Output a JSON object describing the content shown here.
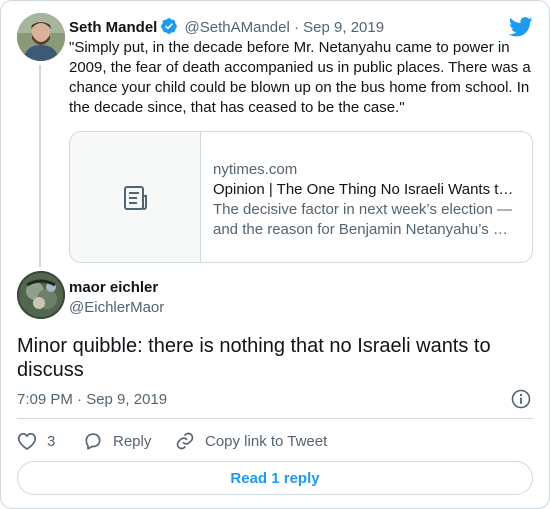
{
  "parent_tweet": {
    "author_name": "Seth Mandel",
    "author_handle": "@SethAMandel",
    "separator": "·",
    "date": "Sep 9, 2019",
    "text": "\"Simply put, in the decade before Mr. Netanyahu came to power in 2009, the fear of death accompanied us in public places. There was a chance your child could be blown up on the bus home from school. In the decade since, that has ceased to be the case.\"",
    "link_card": {
      "domain": "nytimes.com",
      "title": "Opinion | The One Thing No Israeli Wants t…",
      "description_line1": "The decisive factor in next week’s election —",
      "description_line2": "and the reason for Benjamin Netanyahu’s …",
      "thumbnail_icon": "article-icon"
    }
  },
  "reply_tweet": {
    "author_name": "maor eichler",
    "author_handle": "@EichlerMaor",
    "text": "Minor quibble: there is nothing that no Israeli wants to discuss",
    "time": "7:09 PM · Sep 9, 2019"
  },
  "actions": {
    "like_count": "3",
    "reply_label": "Reply",
    "copy_link_label": "Copy link to Tweet"
  },
  "read_replies_label": "Read 1 reply",
  "colors": {
    "accent": "#1d9bf0",
    "text_primary": "#0f1419",
    "text_secondary": "#536471",
    "border": "#cfd9de"
  }
}
